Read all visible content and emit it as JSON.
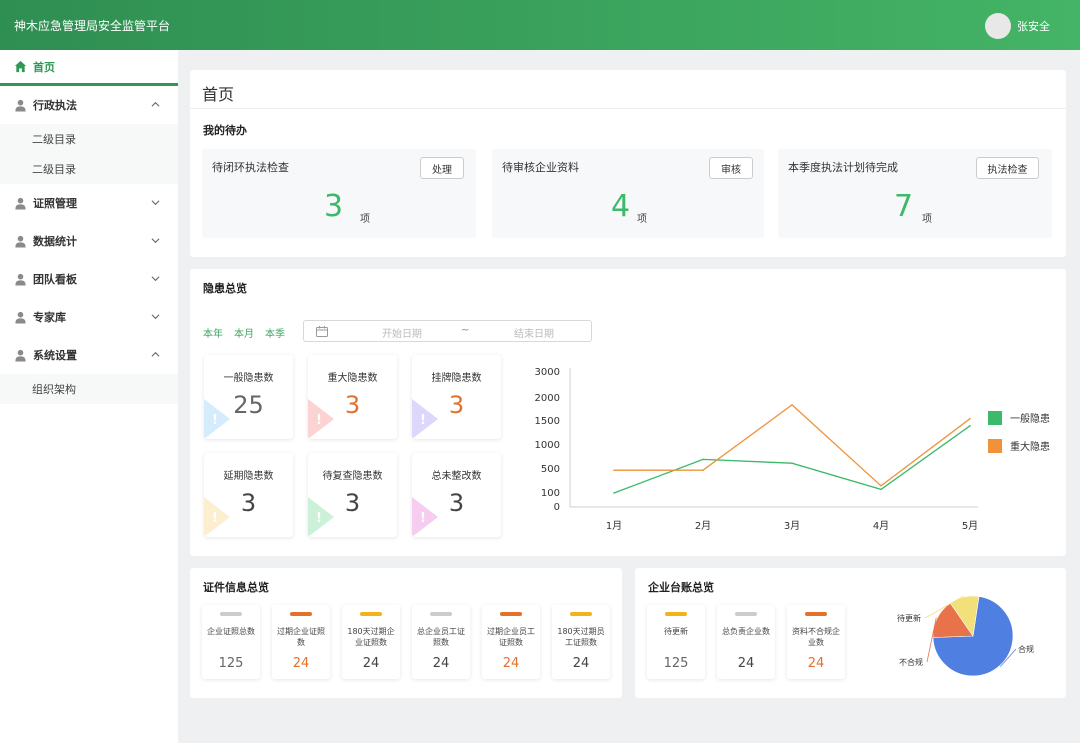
{
  "header": {
    "title": "神木应急管理局安全监管平台",
    "user": "张安全"
  },
  "sidebar": {
    "home": "首页",
    "items": [
      {
        "label": "行政执法",
        "expanded": true,
        "children": [
          "二级目录",
          "二级目录"
        ]
      },
      {
        "label": "证照管理",
        "expanded": false,
        "children": []
      },
      {
        "label": "数据统计",
        "expanded": false,
        "children": []
      },
      {
        "label": "团队看板",
        "expanded": false,
        "children": []
      },
      {
        "label": "专家库",
        "expanded": false,
        "children": []
      },
      {
        "label": "系统设置",
        "expanded": true,
        "children": [
          "组织架构"
        ]
      }
    ]
  },
  "page_title": "首页",
  "todo": {
    "title": "我的待办",
    "cards": [
      {
        "label": "待闭环执法检查",
        "button": "处理",
        "count": "3",
        "unit": "项"
      },
      {
        "label": "待审核企业资料",
        "button": "审核",
        "count": "4",
        "unit": "项"
      },
      {
        "label": "本季度执法计划待完成",
        "button": "执法检查",
        "count": "7",
        "unit": "项"
      }
    ]
  },
  "hazard": {
    "title": "隐患总览",
    "ranges": [
      "本年",
      "本月",
      "本季"
    ],
    "date_start_placeholder": "开始日期",
    "date_sep": "~",
    "date_end_placeholder": "结束日期",
    "stats": [
      {
        "label": "一般隐患数",
        "value": "25",
        "color": "#666666",
        "flag": "#d4ecfb"
      },
      {
        "label": "重大隐患数",
        "value": "3",
        "color": "#e4702a",
        "flag": "#fbd3d3"
      },
      {
        "label": "挂牌隐患数",
        "value": "3",
        "color": "#e4702a",
        "flag": "#ddd8fb"
      },
      {
        "label": "延期隐患数",
        "value": "3",
        "color": "#444444",
        "flag": "#fbefd0"
      },
      {
        "label": "待复查隐患数",
        "value": "3",
        "color": "#444444",
        "flag": "#cdf0d9"
      },
      {
        "label": "总未整改数",
        "value": "3",
        "color": "#444444",
        "flag": "#f6cdf0"
      }
    ]
  },
  "chart_data": {
    "type": "line",
    "categories": [
      "1月",
      "2月",
      "3月",
      "4月",
      "5月"
    ],
    "y_ticks": [
      "0",
      "100",
      "500",
      "1000",
      "1500",
      "2000",
      "3000"
    ],
    "series": [
      {
        "name": "一般隐患",
        "color": "#3cb96a",
        "values": [
          100,
          700,
          620,
          160,
          1400
        ]
      },
      {
        "name": "重大隐患",
        "color": "#f0923a",
        "values": [
          480,
          480,
          1850,
          220,
          1550
        ]
      }
    ],
    "legend_position": "right"
  },
  "cert": {
    "title": "证件信息总览",
    "cards": [
      {
        "label": "企业证照总数",
        "value": "125",
        "bar": "#cccccc",
        "vcolor": "#666666"
      },
      {
        "label": "过期企业证照数",
        "value": "24",
        "bar": "#e4702a",
        "vcolor": "#e4702a"
      },
      {
        "label": "180天过期企业证照数",
        "value": "24",
        "bar": "#f2b21c",
        "vcolor": "#444444"
      },
      {
        "label": "总企业员工证照数",
        "value": "24",
        "bar": "#cccccc",
        "vcolor": "#444444"
      },
      {
        "label": "过期企业员工证照数",
        "value": "24",
        "bar": "#e4702a",
        "vcolor": "#e4702a"
      },
      {
        "label": "180天过期员工证照数",
        "value": "24",
        "bar": "#f2b21c",
        "vcolor": "#444444"
      }
    ]
  },
  "ledger": {
    "title": "企业台账总览",
    "cards": [
      {
        "label": "待更新",
        "value": "125",
        "bar": "#f2b21c",
        "vcolor": "#666666"
      },
      {
        "label": "总负责企业数",
        "value": "24",
        "bar": "#cccccc",
        "vcolor": "#444444"
      },
      {
        "label": "资料不合规企业数",
        "value": "24",
        "bar": "#e4702a",
        "vcolor": "#e4702a"
      }
    ],
    "pie": {
      "slices": [
        {
          "label": "合规",
          "value": 72,
          "color": "#4f7fe0"
        },
        {
          "label": "不合规",
          "value": 16,
          "color": "#e8734a"
        },
        {
          "label": "待更新",
          "value": 12,
          "color": "#f2e07a"
        }
      ]
    }
  }
}
